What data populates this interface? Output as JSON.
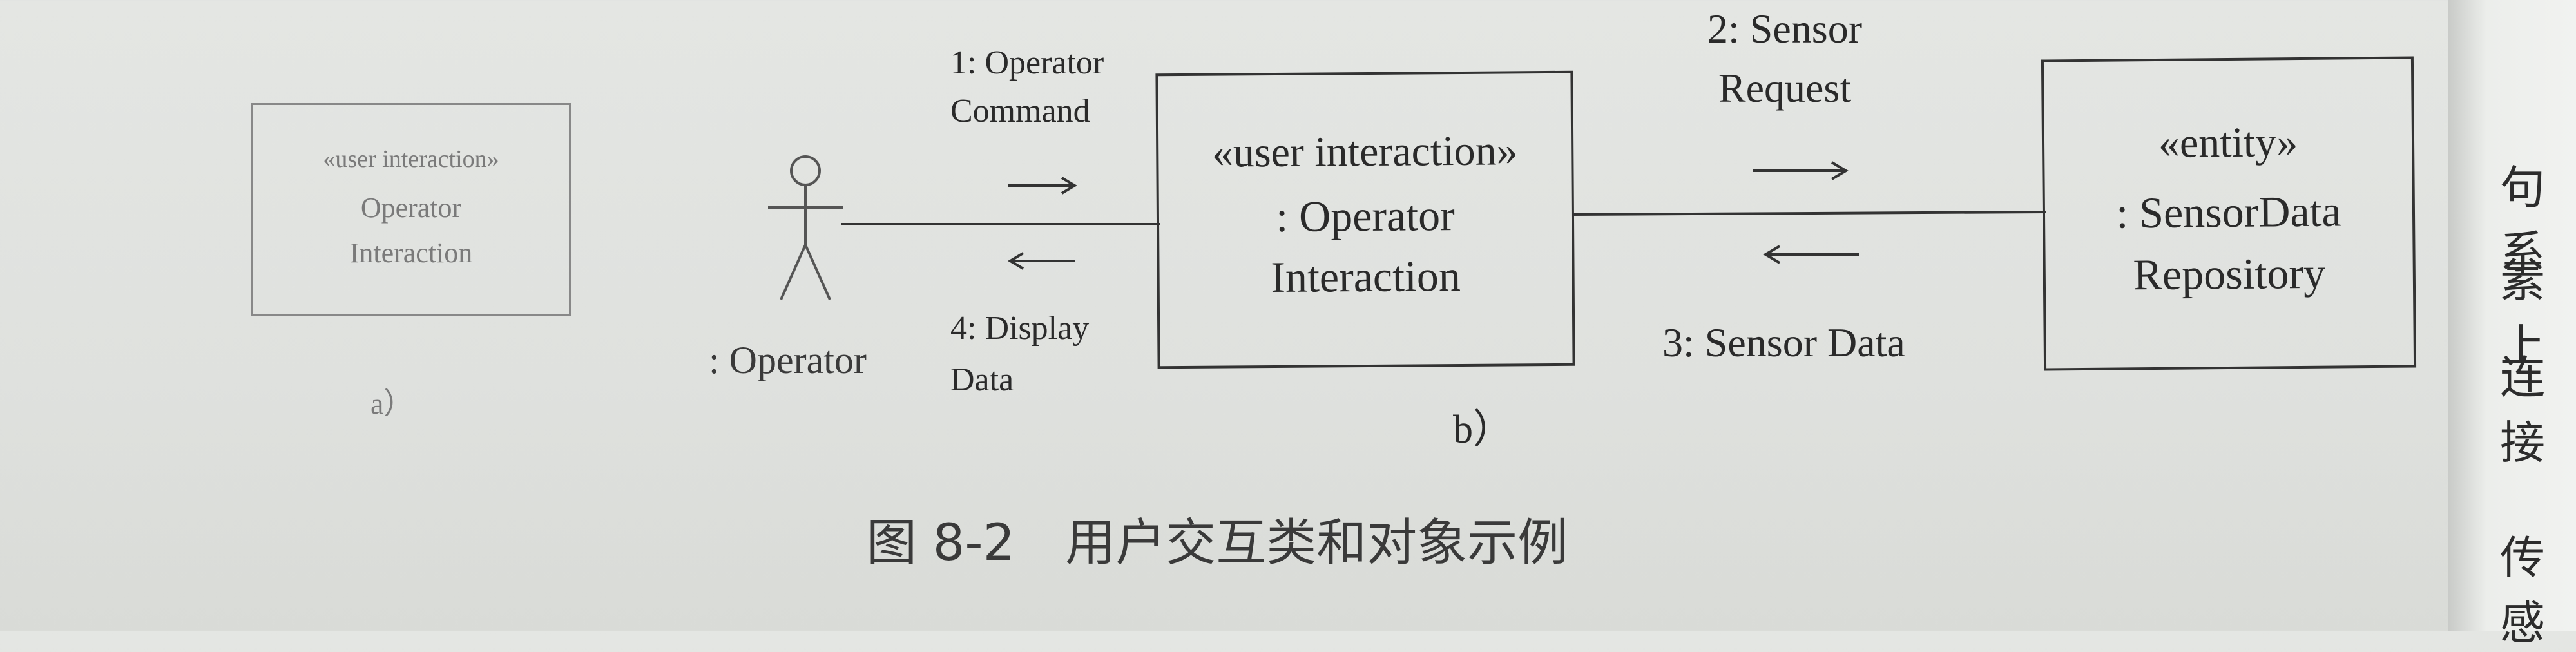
{
  "figure_a": {
    "stereotype": "«user interaction»",
    "name_line1": "Operator",
    "name_line2": "Interaction",
    "caption": "a）"
  },
  "figure_b": {
    "actor_label": ": Operator",
    "interaction_object": {
      "stereotype": "«user interaction»",
      "name_line1": ": Operator",
      "name_line2": "Interaction"
    },
    "entity_object": {
      "stereotype": "«entity»",
      "name_line1": ": SensorData",
      "name_line2": "Repository"
    },
    "messages": {
      "m1_line1": "1: Operator",
      "m1_line2": "Command",
      "m2_line1": "2: Sensor",
      "m2_line2": "Request",
      "m3": "3: Sensor Data",
      "m4_line1": "4: Display",
      "m4_line2": "Data"
    },
    "caption": "b）"
  },
  "figure_caption": "图 8-2　用户交互类和对象示例",
  "side_text": [
    "句系",
    "素上",
    "连接",
    "传感"
  ]
}
